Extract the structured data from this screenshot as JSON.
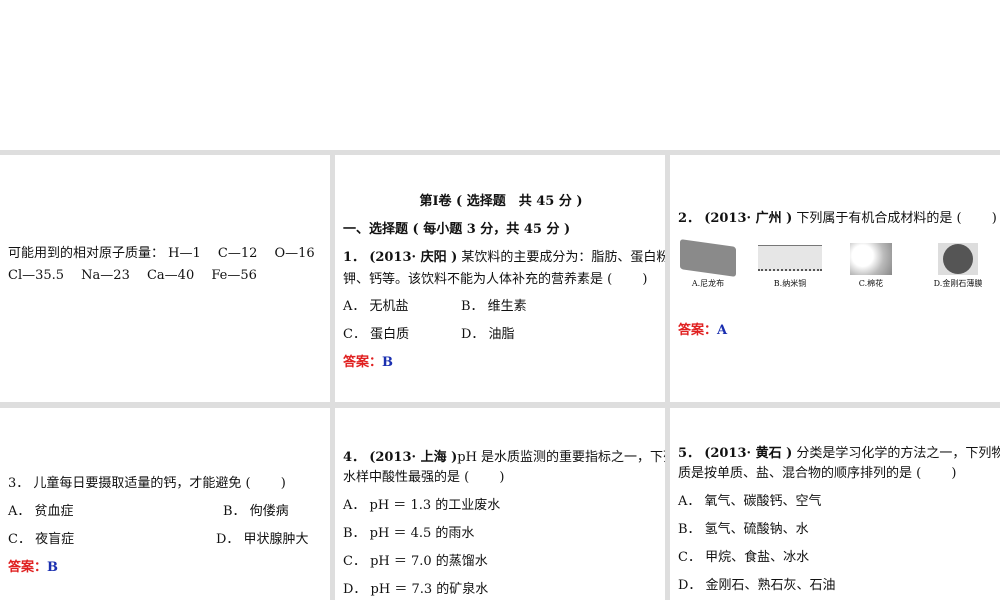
{
  "p1": {
    "line1": "可能用到的相对原子质量： H—1　 C—12　 O—16",
    "line2": "Cl—35.5　 Na—23　 Ca—40　 Fe—56"
  },
  "p2": {
    "heading": "第Ⅰ卷 ( 选择题　共 45 分 )",
    "section": "一、选择题 ( 每小题 3 分，共 45 分 )",
    "q_num": "1．",
    "q_src": "(2013· 庆阳 )",
    "q_text1": " 某饮料的主要成分为：脂肪、蛋白粉、",
    "q_text2": "钾、钙等。该饮料不能为人体补充的营养素是 (　　 )",
    "options": [
      "A． 无机盐",
      "B． 维生素",
      "C． 蛋白质",
      "D． 油脂"
    ],
    "answer_label": "答案：",
    "answer": "B"
  },
  "p3": {
    "q_num": "2．",
    "q_src": "(2013· 广州 )",
    "q_text": " 下列属于有机合成材料的是 (　　 )",
    "captions": [
      "A.尼龙布",
      "B.纳米铜",
      "C.棉花",
      "D.金刚石薄膜"
    ],
    "answer_label": "答案：",
    "answer": "A"
  },
  "p4": {
    "q": "3． 儿童每日要摄取适量的钙，才能避免 (　　 )",
    "options": [
      "A． 贫血症",
      "B． 佝偻病",
      "C． 夜盲症",
      "D． 甲状腺肿大"
    ],
    "answer_label": "答案：",
    "answer": "B"
  },
  "p5": {
    "q_num": "4．",
    "q_src": "(2013· 上海 )",
    "q_text1": "pH 是水质监测的重要指标之一，下列",
    "q_text2": "水样中酸性最强的是 (　　 )",
    "options": [
      "A． pH ＝ 1.3 的工业废水",
      "B． pH ＝ 4.5 的雨水",
      "C． pH ＝ 7.0 的蒸馏水",
      "D． pH ＝ 7.3 的矿泉水"
    ]
  },
  "p6": {
    "q_num": "5．",
    "q_src": "(2013· 黄石 )",
    "q_text1": " 分类是学习化学的方法之一，下列物",
    "q_text2": "质是按单质、盐、混合物的顺序排列的是 (　　 )",
    "options": [
      "A． 氧气、碳酸钙、空气",
      "B． 氢气、硫酸钠、水",
      "C． 甲烷、食盐、冰水",
      "D． 金刚石、熟石灰、石油"
    ]
  }
}
